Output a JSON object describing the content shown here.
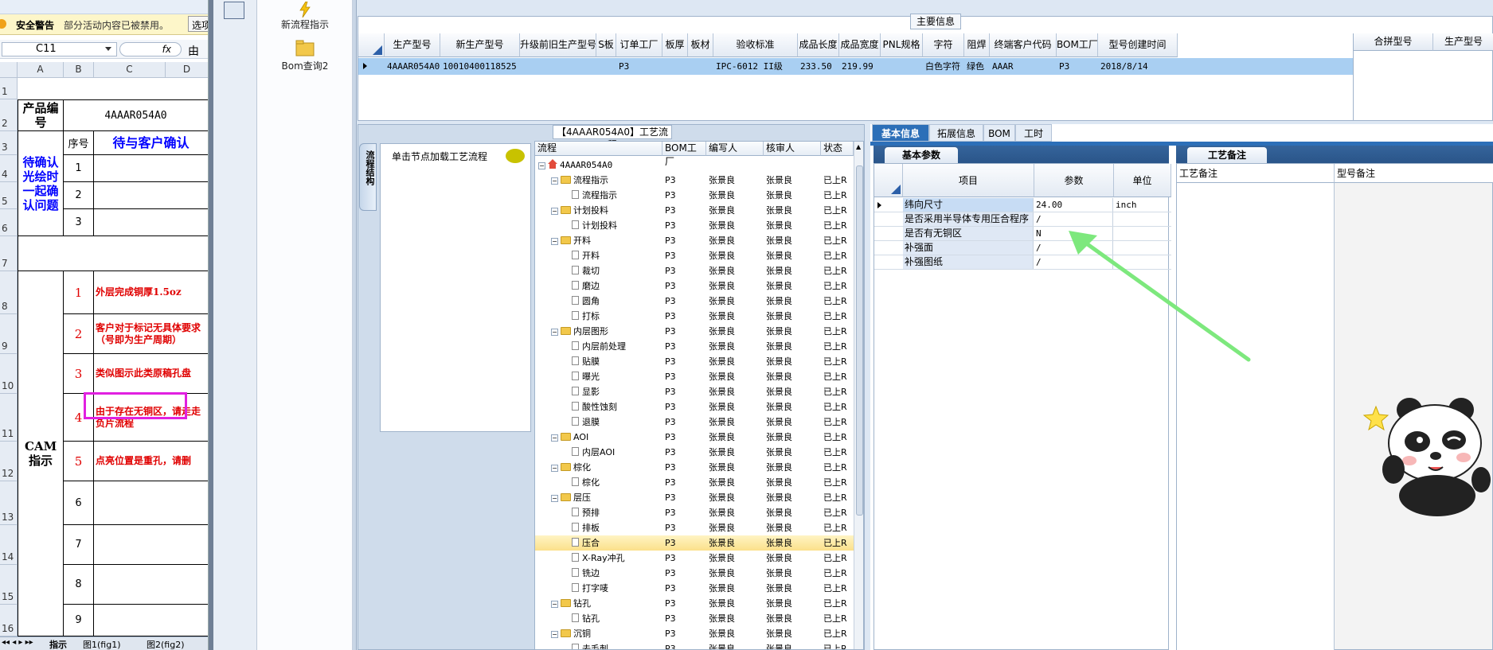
{
  "excel": {
    "warning_title": "安全警告",
    "warning_msg": "部分活动内容已被禁用。",
    "warning_btn": "选项",
    "cell_ref": "C11",
    "fx": "fx",
    "formula_value": "由于",
    "columns": [
      "A",
      "B",
      "C",
      "D"
    ],
    "rows": [
      "1",
      "2",
      "3",
      "4",
      "5",
      "6",
      "7",
      "8",
      "9",
      "10",
      "11",
      "12",
      "13",
      "14",
      "15",
      "16"
    ],
    "product_code_label": "产品编号",
    "product_code": "4AAAR054A0",
    "seq_label": "序号",
    "pending_header": "待与客户确认",
    "pending_label": "待确认光绘时一起确认问题",
    "pending_nums": [
      "1",
      "2",
      "3"
    ],
    "cam_label": "CAM指示",
    "cam_nums": [
      "1",
      "2",
      "3",
      "4",
      "5",
      "6",
      "7",
      "8",
      "9"
    ],
    "cam_texts": [
      "外层完成铜厚1.5oz",
      "客户对于标记无具体要求（号即为生产周期）",
      "类似图示此类原稿孔盘",
      "由于存在无铜区，请走走负片流程",
      "点亮位置是重孔，请删",
      "",
      "",
      "",
      ""
    ],
    "sheet_tabs": [
      "指示",
      "图1(fig1)",
      "图2(fig2)"
    ]
  },
  "nav": {
    "item1": "新流程指示",
    "item2": "Bom查询2"
  },
  "main_info": {
    "title": "主要信息",
    "headers": [
      "生产型号",
      "新生产型号",
      "升级前旧生产型号",
      "S板",
      "订单工厂",
      "板厚",
      "板材",
      "验收标准",
      "成品长度",
      "成品宽度",
      "PNL规格",
      "字符",
      "阻焊",
      "终端客户代码",
      "BOM工厂",
      "型号创建时间"
    ],
    "row": [
      "4AAAR054A0",
      "10010400118525",
      "",
      "",
      "P3",
      "",
      "",
      "IPC-6012 II级",
      "233.50",
      "219.99",
      "",
      "白色字符",
      "绿色",
      "AAAR",
      "P3",
      "2018/8/14"
    ],
    "right_headers": [
      "合拼型号",
      "生产型号"
    ]
  },
  "process": {
    "title": "【4AAAR054A0】工艺流程",
    "vtab": "流程结构",
    "load_hint": "单击节点加载工艺流程",
    "columns": [
      "流程",
      "BOM工厂",
      "编写人",
      "核审人",
      "状态"
    ],
    "root": "4AAAR054A0",
    "rows": [
      {
        "name": "流程指示",
        "folder": true,
        "f": "P3",
        "w": "张景良",
        "r": "张景良",
        "s": "已上R"
      },
      {
        "name": "流程指示",
        "folder": false,
        "f": "P3",
        "w": "张景良",
        "r": "张景良",
        "s": "已上R"
      },
      {
        "name": "计划投料",
        "folder": true,
        "f": "P3",
        "w": "张景良",
        "r": "张景良",
        "s": "已上R"
      },
      {
        "name": "计划投料",
        "folder": false,
        "f": "P3",
        "w": "张景良",
        "r": "张景良",
        "s": "已上R"
      },
      {
        "name": "开料",
        "folder": true,
        "f": "P3",
        "w": "张景良",
        "r": "张景良",
        "s": "已上R"
      },
      {
        "name": "开料",
        "folder": false,
        "f": "P3",
        "w": "张景良",
        "r": "张景良",
        "s": "已上R"
      },
      {
        "name": "裁切",
        "folder": false,
        "f": "P3",
        "w": "张景良",
        "r": "张景良",
        "s": "已上R"
      },
      {
        "name": "磨边",
        "folder": false,
        "f": "P3",
        "w": "张景良",
        "r": "张景良",
        "s": "已上R"
      },
      {
        "name": "圆角",
        "folder": false,
        "f": "P3",
        "w": "张景良",
        "r": "张景良",
        "s": "已上R"
      },
      {
        "name": "打标",
        "folder": false,
        "f": "P3",
        "w": "张景良",
        "r": "张景良",
        "s": "已上R"
      },
      {
        "name": "内层图形",
        "folder": true,
        "f": "P3",
        "w": "张景良",
        "r": "张景良",
        "s": "已上R"
      },
      {
        "name": "内层前处理",
        "folder": false,
        "f": "P3",
        "w": "张景良",
        "r": "张景良",
        "s": "已上R"
      },
      {
        "name": "贴膜",
        "folder": false,
        "f": "P3",
        "w": "张景良",
        "r": "张景良",
        "s": "已上R"
      },
      {
        "name": "曝光",
        "folder": false,
        "f": "P3",
        "w": "张景良",
        "r": "张景良",
        "s": "已上R"
      },
      {
        "name": "显影",
        "folder": false,
        "f": "P3",
        "w": "张景良",
        "r": "张景良",
        "s": "已上R"
      },
      {
        "name": "酸性蚀刻",
        "folder": false,
        "f": "P3",
        "w": "张景良",
        "r": "张景良",
        "s": "已上R"
      },
      {
        "name": "退膜",
        "folder": false,
        "f": "P3",
        "w": "张景良",
        "r": "张景良",
        "s": "已上R"
      },
      {
        "name": "AOI",
        "folder": true,
        "f": "P3",
        "w": "张景良",
        "r": "张景良",
        "s": "已上R"
      },
      {
        "name": "内层AOI",
        "folder": false,
        "f": "P3",
        "w": "张景良",
        "r": "张景良",
        "s": "已上R"
      },
      {
        "name": "棕化",
        "folder": true,
        "f": "P3",
        "w": "张景良",
        "r": "张景良",
        "s": "已上R"
      },
      {
        "name": "棕化",
        "folder": false,
        "f": "P3",
        "w": "张景良",
        "r": "张景良",
        "s": "已上R"
      },
      {
        "name": "层压",
        "folder": true,
        "f": "P3",
        "w": "张景良",
        "r": "张景良",
        "s": "已上R"
      },
      {
        "name": "预排",
        "folder": false,
        "f": "P3",
        "w": "张景良",
        "r": "张景良",
        "s": "已上R"
      },
      {
        "name": "排板",
        "folder": false,
        "f": "P3",
        "w": "张景良",
        "r": "张景良",
        "s": "已上R"
      },
      {
        "name": "压合",
        "folder": false,
        "f": "P3",
        "w": "张景良",
        "r": "张景良",
        "s": "已上R",
        "selected": true
      },
      {
        "name": "X-Ray冲孔",
        "folder": false,
        "f": "P3",
        "w": "张景良",
        "r": "张景良",
        "s": "已上R"
      },
      {
        "name": "铣边",
        "folder": false,
        "f": "P3",
        "w": "张景良",
        "r": "张景良",
        "s": "已上R"
      },
      {
        "name": "打字唛",
        "folder": false,
        "f": "P3",
        "w": "张景良",
        "r": "张景良",
        "s": "已上R"
      },
      {
        "name": "钻孔",
        "folder": true,
        "f": "P3",
        "w": "张景良",
        "r": "张景良",
        "s": "已上R"
      },
      {
        "name": "钻孔",
        "folder": false,
        "f": "P3",
        "w": "张景良",
        "r": "张景良",
        "s": "已上R"
      },
      {
        "name": "沉铜",
        "folder": true,
        "f": "P3",
        "w": "张景良",
        "r": "张景良",
        "s": "已上R"
      },
      {
        "name": "去毛刺",
        "folder": false,
        "f": "P3",
        "w": "张景良",
        "r": "张景良",
        "s": "已上R"
      }
    ]
  },
  "detail": {
    "tabs": [
      "基本信息",
      "拓展信息",
      "BOM",
      "工时"
    ],
    "param_title": "基本参数",
    "param_cols": [
      "项目",
      "参数",
      "单位"
    ],
    "params": [
      {
        "name": "纬向尺寸",
        "value": "24.00",
        "unit": "inch"
      },
      {
        "name": "是否采用半导体专用压合程序",
        "value": "/",
        "unit": ""
      },
      {
        "name": "是否有无铜区",
        "value": "N",
        "unit": ""
      },
      {
        "name": "补强面",
        "value": "/",
        "unit": ""
      },
      {
        "name": "补强图纸",
        "value": "/",
        "unit": ""
      }
    ],
    "remark_title": "工艺备注",
    "remark_cols": [
      "工艺备注",
      "型号备注"
    ]
  }
}
